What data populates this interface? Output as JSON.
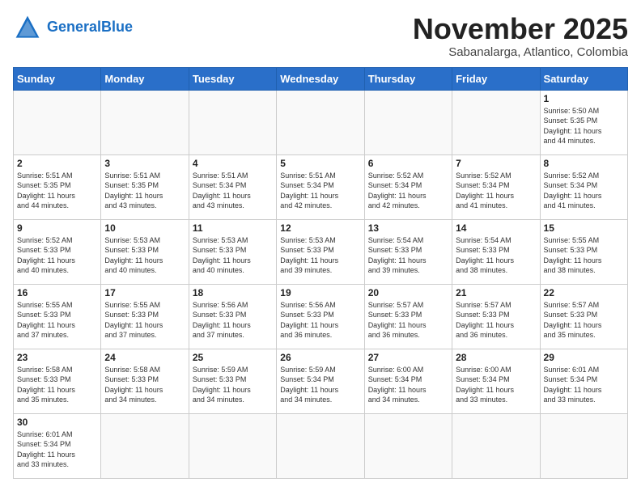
{
  "header": {
    "logo_general": "General",
    "logo_blue": "Blue",
    "month_title": "November 2025",
    "subtitle": "Sabanalarga, Atlantico, Colombia"
  },
  "weekdays": [
    "Sunday",
    "Monday",
    "Tuesday",
    "Wednesday",
    "Thursday",
    "Friday",
    "Saturday"
  ],
  "days": [
    {
      "date": "",
      "info": ""
    },
    {
      "date": "",
      "info": ""
    },
    {
      "date": "",
      "info": ""
    },
    {
      "date": "",
      "info": ""
    },
    {
      "date": "",
      "info": ""
    },
    {
      "date": "",
      "info": ""
    },
    {
      "date": "1",
      "info": "Sunrise: 5:50 AM\nSunset: 5:35 PM\nDaylight: 11 hours\nand 44 minutes."
    },
    {
      "date": "2",
      "info": "Sunrise: 5:51 AM\nSunset: 5:35 PM\nDaylight: 11 hours\nand 44 minutes."
    },
    {
      "date": "3",
      "info": "Sunrise: 5:51 AM\nSunset: 5:35 PM\nDaylight: 11 hours\nand 43 minutes."
    },
    {
      "date": "4",
      "info": "Sunrise: 5:51 AM\nSunset: 5:34 PM\nDaylight: 11 hours\nand 43 minutes."
    },
    {
      "date": "5",
      "info": "Sunrise: 5:51 AM\nSunset: 5:34 PM\nDaylight: 11 hours\nand 42 minutes."
    },
    {
      "date": "6",
      "info": "Sunrise: 5:52 AM\nSunset: 5:34 PM\nDaylight: 11 hours\nand 42 minutes."
    },
    {
      "date": "7",
      "info": "Sunrise: 5:52 AM\nSunset: 5:34 PM\nDaylight: 11 hours\nand 41 minutes."
    },
    {
      "date": "8",
      "info": "Sunrise: 5:52 AM\nSunset: 5:34 PM\nDaylight: 11 hours\nand 41 minutes."
    },
    {
      "date": "9",
      "info": "Sunrise: 5:52 AM\nSunset: 5:33 PM\nDaylight: 11 hours\nand 40 minutes."
    },
    {
      "date": "10",
      "info": "Sunrise: 5:53 AM\nSunset: 5:33 PM\nDaylight: 11 hours\nand 40 minutes."
    },
    {
      "date": "11",
      "info": "Sunrise: 5:53 AM\nSunset: 5:33 PM\nDaylight: 11 hours\nand 40 minutes."
    },
    {
      "date": "12",
      "info": "Sunrise: 5:53 AM\nSunset: 5:33 PM\nDaylight: 11 hours\nand 39 minutes."
    },
    {
      "date": "13",
      "info": "Sunrise: 5:54 AM\nSunset: 5:33 PM\nDaylight: 11 hours\nand 39 minutes."
    },
    {
      "date": "14",
      "info": "Sunrise: 5:54 AM\nSunset: 5:33 PM\nDaylight: 11 hours\nand 38 minutes."
    },
    {
      "date": "15",
      "info": "Sunrise: 5:55 AM\nSunset: 5:33 PM\nDaylight: 11 hours\nand 38 minutes."
    },
    {
      "date": "16",
      "info": "Sunrise: 5:55 AM\nSunset: 5:33 PM\nDaylight: 11 hours\nand 37 minutes."
    },
    {
      "date": "17",
      "info": "Sunrise: 5:55 AM\nSunset: 5:33 PM\nDaylight: 11 hours\nand 37 minutes."
    },
    {
      "date": "18",
      "info": "Sunrise: 5:56 AM\nSunset: 5:33 PM\nDaylight: 11 hours\nand 37 minutes."
    },
    {
      "date": "19",
      "info": "Sunrise: 5:56 AM\nSunset: 5:33 PM\nDaylight: 11 hours\nand 36 minutes."
    },
    {
      "date": "20",
      "info": "Sunrise: 5:57 AM\nSunset: 5:33 PM\nDaylight: 11 hours\nand 36 minutes."
    },
    {
      "date": "21",
      "info": "Sunrise: 5:57 AM\nSunset: 5:33 PM\nDaylight: 11 hours\nand 36 minutes."
    },
    {
      "date": "22",
      "info": "Sunrise: 5:57 AM\nSunset: 5:33 PM\nDaylight: 11 hours\nand 35 minutes."
    },
    {
      "date": "23",
      "info": "Sunrise: 5:58 AM\nSunset: 5:33 PM\nDaylight: 11 hours\nand 35 minutes."
    },
    {
      "date": "24",
      "info": "Sunrise: 5:58 AM\nSunset: 5:33 PM\nDaylight: 11 hours\nand 34 minutes."
    },
    {
      "date": "25",
      "info": "Sunrise: 5:59 AM\nSunset: 5:33 PM\nDaylight: 11 hours\nand 34 minutes."
    },
    {
      "date": "26",
      "info": "Sunrise: 5:59 AM\nSunset: 5:34 PM\nDaylight: 11 hours\nand 34 minutes."
    },
    {
      "date": "27",
      "info": "Sunrise: 6:00 AM\nSunset: 5:34 PM\nDaylight: 11 hours\nand 34 minutes."
    },
    {
      "date": "28",
      "info": "Sunrise: 6:00 AM\nSunset: 5:34 PM\nDaylight: 11 hours\nand 33 minutes."
    },
    {
      "date": "29",
      "info": "Sunrise: 6:01 AM\nSunset: 5:34 PM\nDaylight: 11 hours\nand 33 minutes."
    },
    {
      "date": "30",
      "info": "Sunrise: 6:01 AM\nSunset: 5:34 PM\nDaylight: 11 hours\nand 33 minutes."
    },
    {
      "date": "",
      "info": ""
    },
    {
      "date": "",
      "info": ""
    },
    {
      "date": "",
      "info": ""
    },
    {
      "date": "",
      "info": ""
    },
    {
      "date": "",
      "info": ""
    },
    {
      "date": "",
      "info": ""
    }
  ]
}
